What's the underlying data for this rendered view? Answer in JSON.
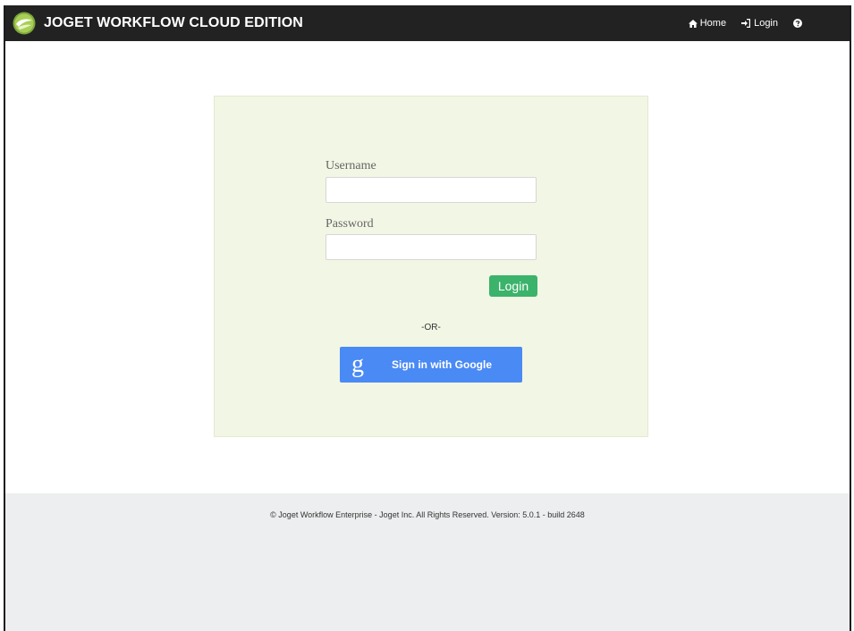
{
  "header": {
    "brand": "JOGET WORKFLOW CLOUD EDITION",
    "nav": {
      "home_label": "Home",
      "login_label": "Login"
    },
    "background_color": "#222222"
  },
  "login_form": {
    "username_label": "Username",
    "username_value": "",
    "password_label": "Password",
    "password_value": "",
    "submit_label": "Login",
    "separator": "-OR-",
    "google_label": "Sign in with Google",
    "google_glyph": "g",
    "panel_color": "#f2f6e4",
    "submit_color": "#3bb36b",
    "google_color": "#4a8af4"
  },
  "footer": {
    "copyright": "© Joget Workflow Enterprise - Joget Inc. All Rights Reserved. Version: 5.0.1 - build 2648",
    "background_color": "#eceeef"
  },
  "icons": {
    "logo": "joget-logo-icon",
    "home": "home-icon",
    "login": "sign-in-icon",
    "help": "help-circle-icon"
  }
}
